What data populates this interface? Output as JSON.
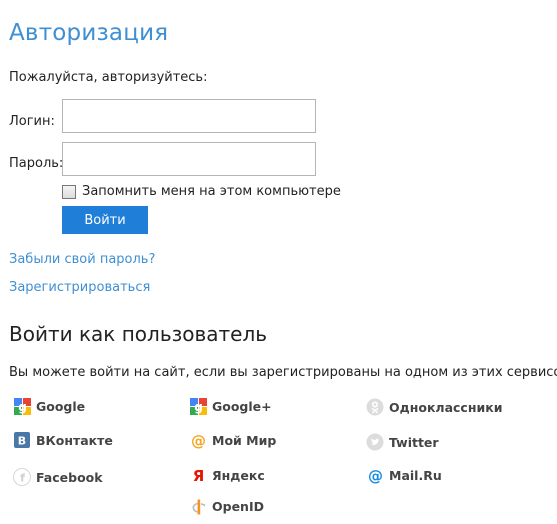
{
  "page_title": "Авторизация",
  "intro": "Пожалуйста, авторизуйтесь:",
  "login_label": "Логин:",
  "password_label": "Пароль:",
  "login_value": "",
  "password_value": "",
  "remember_label": "Запомнить меня на этом компьютере",
  "login_button": "Войти",
  "forgot_link": "Забыли свой пароль?",
  "register_link": "Зарегистрироваться",
  "social_title": "Войти как пользователь",
  "social_desc": "Вы можете войти на сайт, если вы зарегистрированы на одном из этих сервисов:",
  "providers": {
    "google": "Google",
    "google_plus": "Google+",
    "odnoklassniki": "Одноклассники",
    "vkontakte": "ВКонтакте",
    "moy_mir": "Мой Мир",
    "twitter": "Twitter",
    "facebook": "Facebook",
    "yandex": "Яндекс",
    "mailru": "Mail.Ru",
    "openid": "OpenID"
  },
  "colors": {
    "accent": "#3f8fd3",
    "button": "#1f7fd8",
    "vk": "#4a76a8",
    "mail": "#168de2",
    "moymir": "#f5a623",
    "yandex": "#e61400",
    "openid": "#f7931e"
  }
}
